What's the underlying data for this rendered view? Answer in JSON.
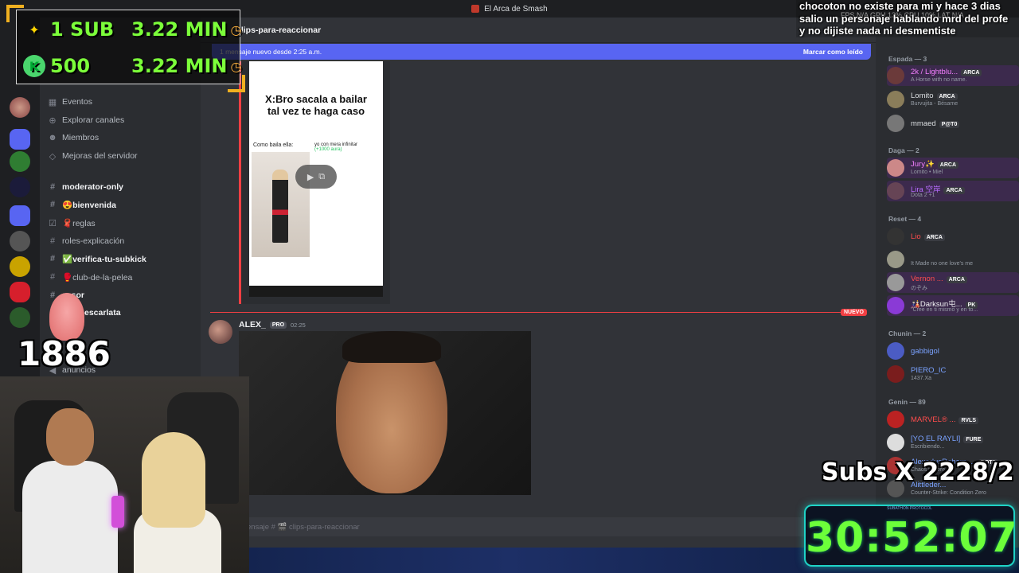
{
  "window": {
    "title": "El Arca de Smash"
  },
  "sidebar": {
    "items": [
      {
        "icon": "calendar-icon",
        "label": "Eventos"
      },
      {
        "icon": "compass-icon",
        "label": "Explorar canales"
      },
      {
        "icon": "members-icon",
        "label": "Miembros"
      },
      {
        "icon": "sparkle-icon",
        "label": "Mejoras del servidor"
      }
    ],
    "channels": [
      {
        "label": "moderator-only",
        "bold": true
      },
      {
        "label": "😍bienvenida",
        "bold": true
      },
      {
        "label": "🧣reglas",
        "bold": false
      },
      {
        "label": "roles-explicación",
        "bold": false
      },
      {
        "label": "✅verifica-tu-subkick",
        "bold": true
      },
      {
        "label": "🥊club-de-la-pelea",
        "bold": false
      },
      {
        "label": "sesor",
        "bold": true
      },
      {
        "label": "nada-escarlata",
        "bold": true
      },
      {
        "label": "anuncios",
        "bold": false
      }
    ]
  },
  "chat": {
    "channel_name": "clips-para-reaccionar",
    "new_messages_text": "1 mensaje nuevo desde 2:25 a.m.",
    "mark_read": "Marcar como leído",
    "clip": {
      "title": "X:Bro sacala a bailar\ntal vez te haga caso",
      "caption_left": "Como baila ella:",
      "caption_right": "yo con mera infinitar",
      "caption_aura": "(+1000 aura)"
    },
    "nuevo_label": "NUEVO",
    "message": {
      "author": "ALEX_",
      "badge": "PRO",
      "time": "02:25"
    },
    "composer_placeholder": "ensaje # 🎬 clips-para-reaccionar"
  },
  "members": {
    "groups": [
      {
        "label": "Espada — 3"
      },
      {
        "label": "Daga — 2"
      },
      {
        "label": "Reset — 4"
      },
      {
        "label": "Chunin — 2"
      },
      {
        "label": "Genin — 89"
      }
    ],
    "list": [
      {
        "name": "2k / Lightblu...",
        "tag": "ARCA",
        "status": "A Horse with no name.",
        "color": "#f47fff",
        "hl": true
      },
      {
        "name": "Lomito",
        "tag": "ARCA",
        "status": "Burvujita - Bésame",
        "color": "#dbdee1",
        "hl": false
      },
      {
        "name": "mmaed",
        "tag": "P@T0",
        "status": "",
        "color": "#dbdee1",
        "hl": false
      },
      {
        "name": "Jury✨",
        "tag": "ARCA",
        "status": "Lomito • Miel",
        "color": "#f47fff",
        "hl": true
      },
      {
        "name": "Lira 空岸",
        "tag": "ARCA",
        "status": "Dota 2 +1",
        "color": "#b86cff",
        "hl": true
      },
      {
        "name": "Lio",
        "tag": "ARCA",
        "status": "",
        "color": "#ff4d4d",
        "hl": false
      },
      {
        "name": "",
        "tag": "",
        "status": "It Made no one love's me",
        "color": "#c0392b",
        "hl": false
      },
      {
        "name": "Vernon ...",
        "tag": "ARCA",
        "status": "のぞみ",
        "color": "#ff4d4d",
        "hl": true
      },
      {
        "name": "🎎Darksun屯...",
        "tag": "PK",
        "status": "\"Cree en ti mismo y en to...",
        "color": "#f2f3f5",
        "hl": true
      },
      {
        "name": "gabbigol",
        "tag": "",
        "status": "",
        "color": "#7aa2ff",
        "hl": false
      },
      {
        "name": "PIERO_IC",
        "tag": "",
        "status": "1437.Xa",
        "color": "#7aa2ff",
        "hl": false
      },
      {
        "name": "MARVEL® ...",
        "tag": "RVLS",
        "status": "",
        "color": "#ff4d4d",
        "hl": false
      },
      {
        "name": "[YO EL RAYLI]",
        "tag": "FURE",
        "status": "Escribiendo...",
        "color": "#7aa2ff",
        "hl": false
      },
      {
        "name": "AlexodusReborn ...",
        "tag": "DOTA",
        "status": "Chaos is here",
        "color": "#7aa2ff",
        "hl": false
      },
      {
        "name": "Alittleder...",
        "tag": "",
        "status": "Counter-Strike: Condition Zero",
        "color": "#7aa2ff",
        "hl": false
      }
    ]
  },
  "overlays": {
    "goals": [
      {
        "icon": "sparkle-icon",
        "label": "1 SUB",
        "time": "3.22 MIN"
      },
      {
        "icon": "kick-icon",
        "label": "500",
        "time": "3.22 MIN"
      }
    ],
    "notice": "chocoton no existe para mi y hace 3 dias salio un personaje hablando mrd del profe y no dijiste nada ni desmentiste",
    "perf": "FPS N/A   GPU 13%   CPU 10%   LAT N/A",
    "viewer_count": "1886",
    "subs_text": "Subs X 2228/2",
    "timer": "30:52:07",
    "timer_label": "SUBATHON PROTOCOL"
  },
  "colors": {
    "blurple": "#5865f2",
    "red": "#f23f43",
    "timer_green": "#6cff3a",
    "timer_border": "#1fd3c6"
  }
}
